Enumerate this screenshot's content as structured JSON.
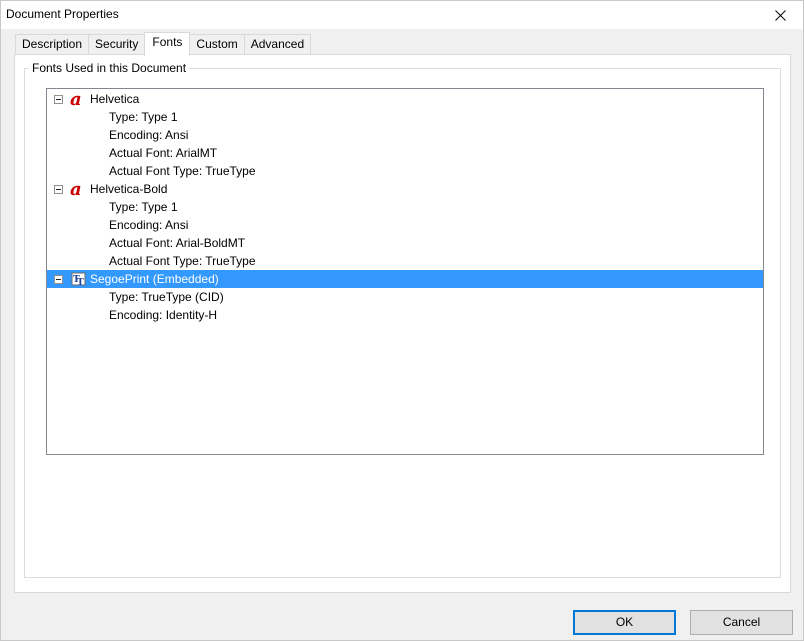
{
  "window": {
    "title": "Document Properties",
    "close_label": "×"
  },
  "tabs": [
    {
      "label": "Description"
    },
    {
      "label": "Security"
    },
    {
      "label": "Fonts",
      "active": true
    },
    {
      "label": "Custom"
    },
    {
      "label": "Advanced"
    }
  ],
  "group": {
    "label": "Fonts Used in this Document"
  },
  "fonts": [
    {
      "name": "Helvetica",
      "icon": "type1-font-icon",
      "expanded": true,
      "properties": [
        "Type: Type 1",
        "Encoding: Ansi",
        "Actual Font: ArialMT",
        "Actual Font Type: TrueType"
      ]
    },
    {
      "name": "Helvetica-Bold",
      "icon": "type1-font-icon",
      "expanded": true,
      "properties": [
        "Type: Type 1",
        "Encoding: Ansi",
        "Actual Font: Arial-BoldMT",
        "Actual Font Type: TrueType"
      ]
    },
    {
      "name": "SegoePrint (Embedded)",
      "icon": "truetype-font-icon",
      "expanded": true,
      "selected": true,
      "properties": [
        "Type: TrueType (CID)",
        "Encoding: Identity-H"
      ]
    }
  ],
  "buttons": {
    "ok": "OK",
    "cancel": "Cancel"
  },
  "colors": {
    "selection": "#3399ff",
    "type1_icon": "#cc0000",
    "dialog_bg": "#f0f0f0"
  }
}
